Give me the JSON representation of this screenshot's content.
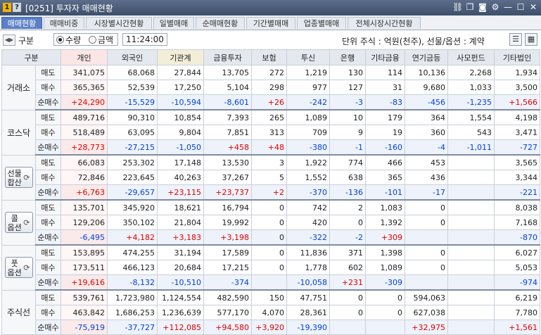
{
  "window": {
    "num1": "1",
    "num2": "?",
    "title": "[0251] 투자자 매매현황"
  },
  "title_icons": [
    "link-icon",
    "copy-icon",
    "camera-icon",
    "gear-icon",
    "minimize-icon",
    "maximize-icon",
    "close-icon"
  ],
  "tabs": [
    "매매현황",
    "매매비중",
    "시장별시간현황",
    "일별매매",
    "순매매현황",
    "기간별매매",
    "업종별매매",
    "전체시장시간현황"
  ],
  "toolbar": {
    "gubun": "구분",
    "radio_qty": "수량",
    "radio_amt": "금액",
    "time": "11:24:00",
    "unit": "단위 주식 : 억원(천주), 선물/옵션 : 계약"
  },
  "headers": [
    "구분",
    "",
    "개인",
    "외국인",
    "기관계",
    "금융투자",
    "보험",
    "투신",
    "은행",
    "기타금융",
    "연기금등",
    "사모펀드",
    "기타법인"
  ],
  "groups": [
    {
      "name": "거래소",
      "button": false,
      "rows": [
        {
          "label": "매도",
          "cells": [
            "341,075",
            "68,068",
            "27,844",
            "13,705",
            "272",
            "1,219",
            "130",
            "114",
            "10,136",
            "2,268",
            "1,934"
          ]
        },
        {
          "label": "매수",
          "cells": [
            "365,365",
            "52,539",
            "17,250",
            "5,104",
            "298",
            "977",
            "127",
            "31",
            "9,680",
            "1,033",
            "3,500"
          ]
        },
        {
          "label": "순매수",
          "cells": [
            "+24,290",
            "-15,529",
            "-10,594",
            "-8,601",
            "+26",
            "-242",
            "-3",
            "-83",
            "-456",
            "-1,235",
            "+1,566"
          ]
        }
      ]
    },
    {
      "name": "코스닥",
      "button": false,
      "rows": [
        {
          "label": "매도",
          "cells": [
            "489,716",
            "90,310",
            "10,854",
            "7,393",
            "265",
            "1,089",
            "10",
            "179",
            "364",
            "1,554",
            "4,198"
          ]
        },
        {
          "label": "매수",
          "cells": [
            "518,489",
            "63,095",
            "9,804",
            "7,851",
            "313",
            "709",
            "9",
            "19",
            "360",
            "543",
            "3,471"
          ]
        },
        {
          "label": "순매수",
          "cells": [
            "+28,773",
            "-27,215",
            "-1,050",
            "+458",
            "+48",
            "-380",
            "-1",
            "-160",
            "-4",
            "-1,011",
            "-727"
          ]
        }
      ]
    },
    {
      "name": "선물\n합산",
      "button": true,
      "rows": [
        {
          "label": "매도",
          "cells": [
            "66,083",
            "253,302",
            "17,148",
            "13,530",
            "3",
            "1,922",
            "774",
            "466",
            "453",
            "",
            "3,565"
          ]
        },
        {
          "label": "매수",
          "cells": [
            "72,846",
            "223,645",
            "40,263",
            "37,267",
            "5",
            "1,552",
            "638",
            "365",
            "436",
            "",
            "3,344"
          ]
        },
        {
          "label": "순매수",
          "cells": [
            "+6,763",
            "-29,657",
            "+23,115",
            "+23,737",
            "+2",
            "-370",
            "-136",
            "-101",
            "-17",
            "",
            "-221"
          ]
        }
      ]
    },
    {
      "name": "콜\n옵션",
      "button": true,
      "rows": [
        {
          "label": "매도",
          "cells": [
            "135,701",
            "345,920",
            "18,621",
            "16,794",
            "0",
            "742",
            "2",
            "1,083",
            "0",
            "",
            "8,038"
          ]
        },
        {
          "label": "매수",
          "cells": [
            "129,206",
            "350,102",
            "21,804",
            "19,992",
            "0",
            "420",
            "0",
            "1,392",
            "0",
            "",
            "7,168"
          ]
        },
        {
          "label": "순매수",
          "cells": [
            "-6,495",
            "+4,182",
            "+3,183",
            "+3,198",
            "0",
            "-322",
            "-2",
            "+309",
            "",
            "",
            "-870"
          ]
        }
      ]
    },
    {
      "name": "풋\n옵션",
      "button": true,
      "rows": [
        {
          "label": "매도",
          "cells": [
            "153,895",
            "474,255",
            "31,194",
            "17,589",
            "0",
            "11,836",
            "371",
            "1,398",
            "0",
            "",
            "6,027"
          ]
        },
        {
          "label": "매수",
          "cells": [
            "173,511",
            "466,123",
            "20,684",
            "17,215",
            "0",
            "1,778",
            "602",
            "1,089",
            "0",
            "",
            "5,053"
          ]
        },
        {
          "label": "순매수",
          "cells": [
            "+19,616",
            "-8,132",
            "-10,510",
            "-374",
            "",
            "-10,058",
            "+231",
            "-309",
            "",
            "",
            "-974"
          ]
        }
      ]
    },
    {
      "name": "주식선",
      "button": false,
      "rows": [
        {
          "label": "매도",
          "cells": [
            "539,761",
            "1,723,980",
            "1,124,554",
            "482,590",
            "150",
            "47,751",
            "0",
            "0",
            "594,063",
            "",
            "6,219"
          ]
        },
        {
          "label": "매수",
          "cells": [
            "463,842",
            "1,686,253",
            "1,236,639",
            "577,170",
            "4,070",
            "28,361",
            "0",
            "0",
            "627,038",
            "",
            "7,780"
          ]
        },
        {
          "label": "순매수",
          "cells": [
            "-75,919",
            "-37,727",
            "+112,085",
            "+94,580",
            "+3,920",
            "-19,390",
            "",
            "",
            "+32,975",
            "",
            "+1,561"
          ]
        }
      ]
    }
  ],
  "colors": {
    "positive": "#e00000",
    "negative": "#0040e0",
    "tab_active": "#5b80c8",
    "titlebar": "#3e4f6b"
  }
}
